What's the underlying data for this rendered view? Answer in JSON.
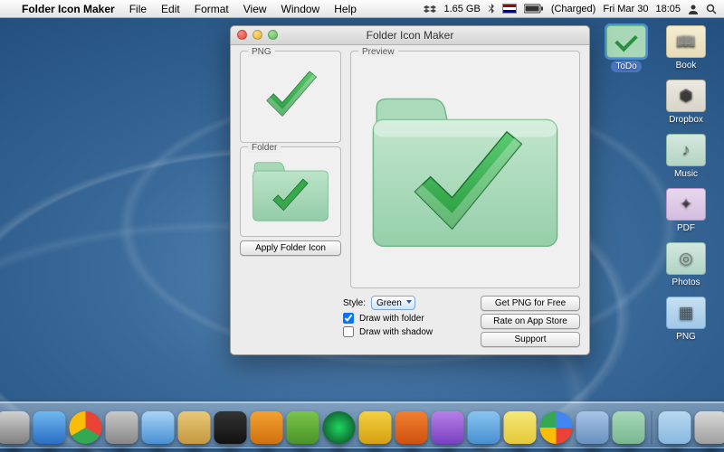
{
  "menubar": {
    "app_name": "Folder Icon Maker",
    "items": [
      "File",
      "Edit",
      "Format",
      "View",
      "Window",
      "Help"
    ],
    "status": {
      "memory": "1.65 GB",
      "charge": "(Charged)",
      "day_date": "Fri Mar 30",
      "time": "18:05"
    }
  },
  "desktop": {
    "icons": [
      {
        "label": "ToDo",
        "kind": "todo",
        "selected": true
      },
      {
        "label": "Book",
        "kind": "book"
      },
      {
        "label": "Dropbox",
        "kind": "dropbox"
      },
      {
        "label": "Music",
        "kind": "music"
      },
      {
        "label": "PDF",
        "kind": "pdf"
      },
      {
        "label": "Photos",
        "kind": "photos"
      },
      {
        "label": "PNG",
        "kind": "png"
      }
    ]
  },
  "window": {
    "title": "Folder Icon Maker",
    "png_legend": "PNG",
    "folder_legend": "Folder",
    "preview_legend": "Preview",
    "apply_btn": "Apply Folder Icon",
    "style_label": "Style:",
    "style_value": "Green",
    "style_options": [
      "Green"
    ],
    "draw_folder_label": "Draw with folder",
    "draw_folder_checked": true,
    "draw_shadow_label": "Draw with shadow",
    "draw_shadow_checked": false,
    "btn_get_png": "Get PNG for Free",
    "btn_rate": "Rate on App Store",
    "btn_support": "Support",
    "colors": {
      "folder_fill": "#a6d6b6",
      "folder_stroke": "#6eb588",
      "check_fill": "#38a84c",
      "check_dark": "#2a803a"
    }
  },
  "dock": {
    "items": [
      "finder",
      "safari-compass",
      "app-store",
      "chrome",
      "system-preferences",
      "xcode",
      "mail",
      "terminal",
      "rocket-app",
      "evernote",
      "spotify",
      "cyberduck",
      "vlc",
      "itunes",
      "pages",
      "stickies",
      "google",
      "abstract-app",
      "folder-icon-maker"
    ],
    "right": [
      "applications-folder",
      "downloads-stack",
      "trash"
    ]
  }
}
